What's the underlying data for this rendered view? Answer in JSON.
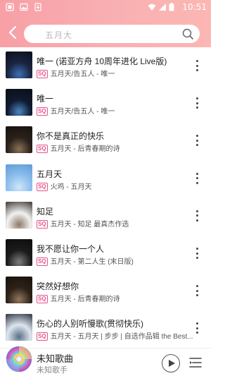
{
  "status": {
    "time": "10:51"
  },
  "search": {
    "query": "五月大"
  },
  "songs": [
    {
      "title": "唯一 (诺亚方舟 10周年进化 Live版)",
      "quality": "SQ",
      "meta": "五月天/告五人 - 唯一",
      "cover": [
        "#1a2540",
        "#3e6fb6",
        "#0a0f1e"
      ]
    },
    {
      "title": "唯一",
      "quality": "SQ",
      "meta": "五月天/告五人 - 唯一",
      "cover": [
        "#101a30",
        "#4b86c4",
        "#0b0e18"
      ]
    },
    {
      "title": "你不是真正的快乐",
      "quality": "SQ",
      "meta": "五月天 - 后青春期的诗",
      "cover": [
        "#2b211a",
        "#8a7156",
        "#17110d"
      ]
    },
    {
      "title": "五月天",
      "quality": "SQ",
      "meta": "火鸡 - 五月天",
      "cover": [
        "#8fc0ee",
        "#cfe5fa",
        "#5e9ad6"
      ]
    },
    {
      "title": "知足",
      "quality": "SQ",
      "meta": "五月天 - 知足 最真杰作选",
      "cover": [
        "#f2f2f2",
        "#8d7a6a",
        "#3c3530"
      ]
    },
    {
      "title": "我不愿让你一个人",
      "quality": "SQ",
      "meta": "五月天 - 第二人生 (末日版)",
      "cover": [
        "#1c1c1c",
        "#7e7e7e",
        "#0c0c0c"
      ]
    },
    {
      "title": "突然好想你",
      "quality": "SQ",
      "meta": "五月天 - 后青春期的诗",
      "cover": [
        "#2d2218",
        "#93775b",
        "#18120c"
      ]
    },
    {
      "title": "伤心的人别听慢歌(贯彻快乐)",
      "quality": "SQ",
      "meta": "五月天 - 五月天 | 步步 | 自选作品辑 the Best...",
      "cover": [
        "#dde6ee",
        "#5b6f86",
        "#2a3340"
      ]
    }
  ],
  "player": {
    "title": "未知歌曲",
    "artist": "未知歌手"
  },
  "colors": {
    "header_start": "#f7a0a6",
    "header_end": "#fbb7b3",
    "sq_badge": "#e4548c"
  }
}
